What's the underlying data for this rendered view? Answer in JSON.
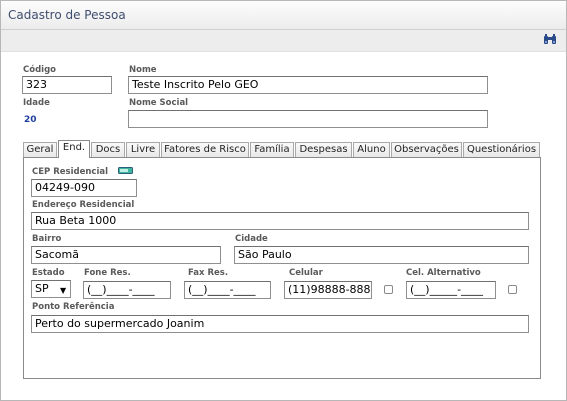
{
  "window": {
    "title": "Cadastro de Pessoa"
  },
  "toolbar": {
    "search_icon": "binoculars-icon"
  },
  "header": {
    "codigo_label": "Código",
    "codigo_value": "323",
    "nome_label": "Nome",
    "nome_value": "Teste Inscrito Pelo GEO",
    "idade_label": "Idade",
    "idade_value": "20",
    "nome_social_label": "Nome Social",
    "nome_social_value": ""
  },
  "tabs": [
    {
      "label": "Geral"
    },
    {
      "label": "End."
    },
    {
      "label": "Docs"
    },
    {
      "label": "Livre"
    },
    {
      "label": "Fatores de Risco"
    },
    {
      "label": "Família"
    },
    {
      "label": "Despesas"
    },
    {
      "label": "Aluno"
    },
    {
      "label": "Observações"
    },
    {
      "label": "Questionários"
    }
  ],
  "active_tab": "End.",
  "endereco": {
    "cep_label": "CEP Residencial",
    "cep_value": "04249-090",
    "endereco_label": "Endereço Residencial",
    "endereco_value": "Rua Beta 1000",
    "bairro_label": "Bairro",
    "bairro_value": "Sacomã",
    "cidade_label": "Cidade",
    "cidade_value": "São Paulo",
    "estado_label": "Estado",
    "estado_value": "SP",
    "fone_label": "Fone Res.",
    "fone_value": "(__)____-____",
    "fax_label": "Fax Res.",
    "fax_value": "(__)____-____",
    "celular_label": "Celular",
    "celular_value": "(11)98888-8888",
    "celular_checked": false,
    "cel_alt_label": "Cel. Alternativo",
    "cel_alt_value": "(__)_____-____",
    "cel_alt_checked": false,
    "ponto_label": "Ponto Referência",
    "ponto_value": "Perto do supermercado Joanim"
  },
  "colors": {
    "accent": "#1f3fa0",
    "title_text": "#3f4d6e"
  }
}
